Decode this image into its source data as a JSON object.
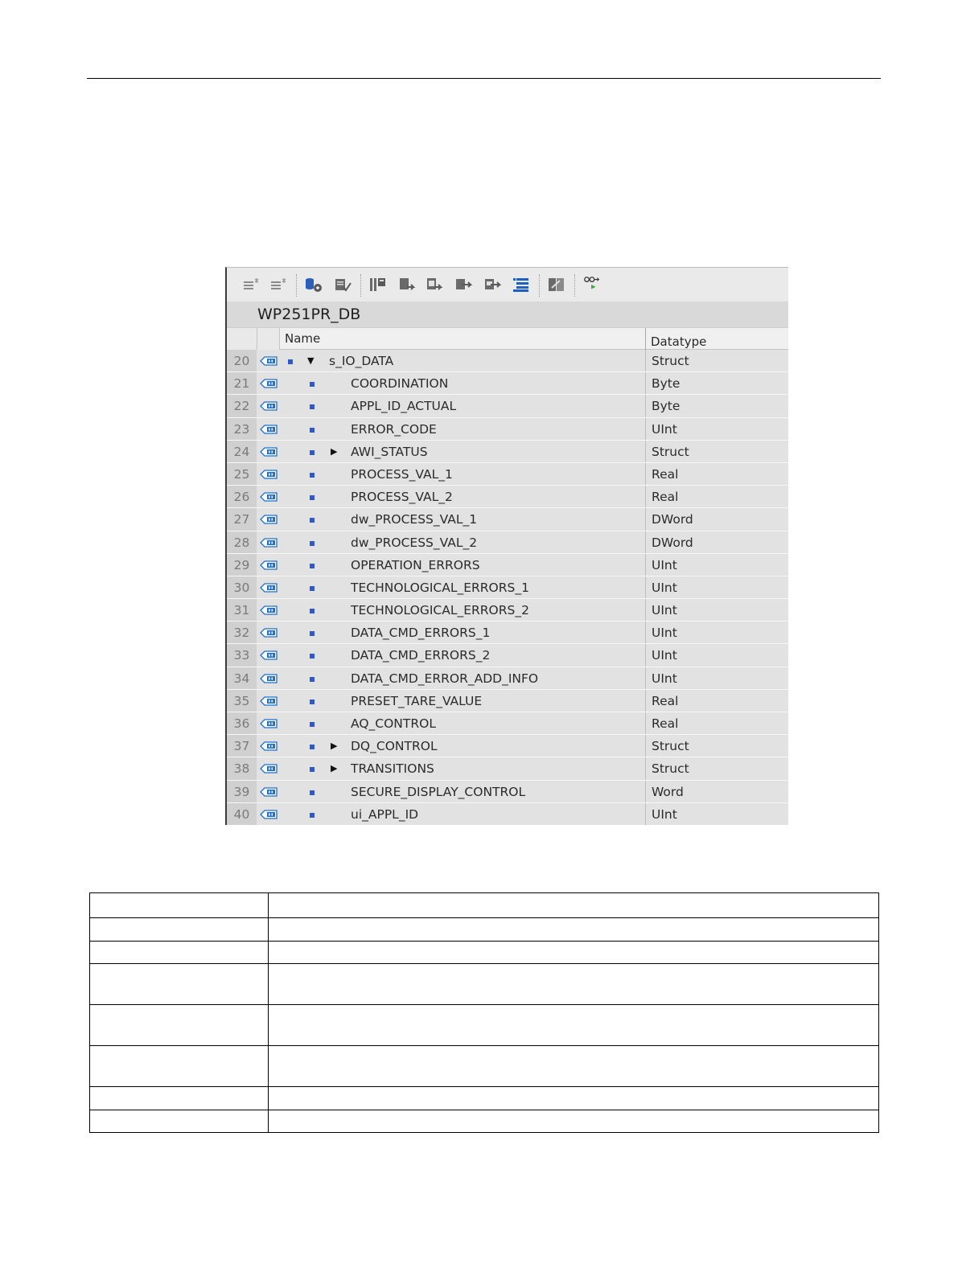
{
  "db_editor": {
    "title": "WP251PR_DB",
    "toolbar_icons": [
      "insert-row-icon",
      "add-row-icon",
      "load-snapshot-icon",
      "copy-snapshot-icon",
      "snapshot-view-icon",
      "copy-to-start-icon",
      "load-start-icon",
      "save-icon",
      "export-icon",
      "expand-all-icon",
      "settings-icon",
      "monitor-icon"
    ],
    "columns": {
      "name": "Name",
      "datatype": "Datatype"
    },
    "rows": [
      {
        "num": "20",
        "name": "s_IO_DATA",
        "type": "Struct",
        "level": 0,
        "arrow": "down"
      },
      {
        "num": "21",
        "name": "COORDINATION",
        "type": "Byte",
        "level": 1,
        "arrow": ""
      },
      {
        "num": "22",
        "name": "APPL_ID_ACTUAL",
        "type": "Byte",
        "level": 1,
        "arrow": ""
      },
      {
        "num": "23",
        "name": "ERROR_CODE",
        "type": "UInt",
        "level": 1,
        "arrow": ""
      },
      {
        "num": "24",
        "name": "AWI_STATUS",
        "type": "Struct",
        "level": 1,
        "arrow": "right"
      },
      {
        "num": "25",
        "name": "PROCESS_VAL_1",
        "type": "Real",
        "level": 1,
        "arrow": ""
      },
      {
        "num": "26",
        "name": "PROCESS_VAL_2",
        "type": "Real",
        "level": 1,
        "arrow": ""
      },
      {
        "num": "27",
        "name": "dw_PROCESS_VAL_1",
        "type": "DWord",
        "level": 1,
        "arrow": ""
      },
      {
        "num": "28",
        "name": "dw_PROCESS_VAL_2",
        "type": "DWord",
        "level": 1,
        "arrow": ""
      },
      {
        "num": "29",
        "name": "OPERATION_ERRORS",
        "type": "UInt",
        "level": 1,
        "arrow": ""
      },
      {
        "num": "30",
        "name": "TECHNOLOGICAL_ERRORS_1",
        "type": "UInt",
        "level": 1,
        "arrow": ""
      },
      {
        "num": "31",
        "name": "TECHNOLOGICAL_ERRORS_2",
        "type": "UInt",
        "level": 1,
        "arrow": ""
      },
      {
        "num": "32",
        "name": "DATA_CMD_ERRORS_1",
        "type": "UInt",
        "level": 1,
        "arrow": ""
      },
      {
        "num": "33",
        "name": "DATA_CMD_ERRORS_2",
        "type": "UInt",
        "level": 1,
        "arrow": ""
      },
      {
        "num": "34",
        "name": "DATA_CMD_ERROR_ADD_INFO",
        "type": "UInt",
        "level": 1,
        "arrow": ""
      },
      {
        "num": "35",
        "name": "PRESET_TARE_VALUE",
        "type": "Real",
        "level": 1,
        "arrow": ""
      },
      {
        "num": "36",
        "name": "AQ_CONTROL",
        "type": "Real",
        "level": 1,
        "arrow": ""
      },
      {
        "num": "37",
        "name": "DQ_CONTROL",
        "type": "Struct",
        "level": 1,
        "arrow": "right"
      },
      {
        "num": "38",
        "name": "TRANSITIONS",
        "type": "Struct",
        "level": 1,
        "arrow": "right"
      },
      {
        "num": "39",
        "name": "SECURE_DISPLAY_CONTROL",
        "type": "Word",
        "level": 1,
        "arrow": ""
      },
      {
        "num": "40",
        "name": "ui_APPL_ID",
        "type": "UInt",
        "level": 1,
        "arrow": ""
      }
    ]
  },
  "doc_table": {
    "rows": [
      {
        "tall": false
      },
      {
        "tall": false
      },
      {
        "tall": false
      },
      {
        "tall": true
      },
      {
        "tall": true
      },
      {
        "tall": true
      },
      {
        "tall": false
      },
      {
        "tall": false
      }
    ]
  },
  "colors": {
    "square_blue": "#2f58c8",
    "io_icon_blue": "#1f6fc8"
  }
}
